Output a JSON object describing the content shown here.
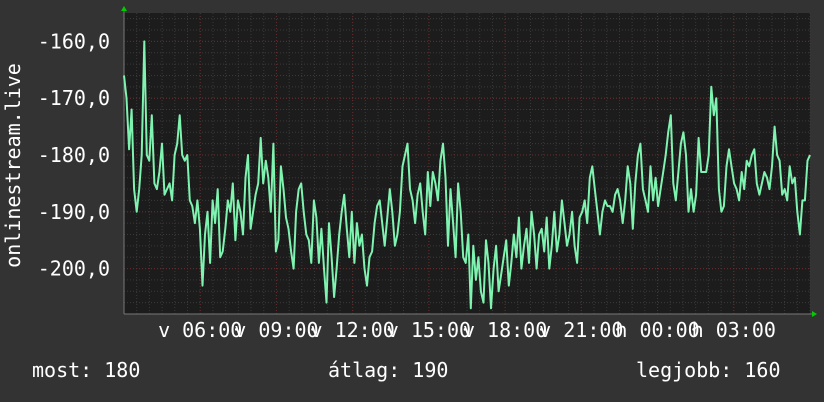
{
  "chart_data": {
    "type": "line",
    "ylabel": "onlinestream.live",
    "ylim": [
      -208,
      -155
    ],
    "yticks": [
      -160,
      -170,
      -180,
      -190,
      -200
    ],
    "ytick_labels": [
      "-160,0",
      "-170,0",
      "-180,0",
      "-190,0",
      "-200,0"
    ],
    "xlim": [
      0,
      270
    ],
    "xticks": [
      {
        "label": "v 06:00",
        "x": 30
      },
      {
        "label": "v 09:00",
        "x": 60
      },
      {
        "label": "v 12:00",
        "x": 90
      },
      {
        "label": "v 15:00",
        "x": 120
      },
      {
        "label": "v 18:00",
        "x": 150
      },
      {
        "label": "v 21:00",
        "x": 180
      },
      {
        "label": "h 00:00",
        "x": 210
      },
      {
        "label": "h 03:00",
        "x": 240
      }
    ],
    "grid": true,
    "colors": {
      "line": "#7ff3b0",
      "plot_bg": "#1c1c1c",
      "grid_minor": "#3a3a3a",
      "grid_major": "#6a2a2a",
      "axis_arrow": "#00cc00"
    },
    "series": [
      {
        "values": [
          -166,
          -170,
          -179,
          -172,
          -186,
          -190,
          -186,
          -180,
          -160,
          -180,
          -181,
          -173,
          -185,
          -186,
          -183,
          -178,
          -187,
          -186,
          -185,
          -188,
          -180,
          -178,
          -173,
          -180,
          -181,
          -180,
          -188,
          -189,
          -192,
          -188,
          -193,
          -203,
          -194,
          -190,
          -199,
          -188,
          -192,
          -186,
          -198,
          -197,
          -193,
          -188,
          -190,
          -185,
          -195,
          -188,
          -190,
          -194,
          -184,
          -180,
          -193,
          -190,
          -187,
          -185,
          -177,
          -185,
          -181,
          -184,
          -190,
          -178,
          -197,
          -195,
          -182,
          -186,
          -191,
          -193,
          -197,
          -200,
          -190,
          -186,
          -185,
          -190,
          -194,
          -195,
          -199,
          -188,
          -191,
          -199,
          -193,
          -200,
          -206,
          -192,
          -198,
          -205,
          -200,
          -194,
          -190,
          -187,
          -193,
          -198,
          -190,
          -199,
          -192,
          -196,
          -194,
          -200,
          -203,
          -198,
          -197,
          -192,
          -189,
          -188,
          -192,
          -196,
          -191,
          -186,
          -190,
          -196,
          -194,
          -190,
          -182,
          -180,
          -178,
          -186,
          -188,
          -192,
          -187,
          -185,
          -190,
          -194,
          -183,
          -189,
          -183,
          -185,
          -188,
          -181,
          -178,
          -184,
          -196,
          -186,
          -192,
          -198,
          -185,
          -190,
          -198,
          -199,
          -194,
          -207,
          -196,
          -202,
          -198,
          -204,
          -206,
          -195,
          -199,
          -207,
          -200,
          -196,
          -204,
          -201,
          -198,
          -195,
          -203,
          -199,
          -194,
          -198,
          -191,
          -200,
          -196,
          -193,
          -199,
          -190,
          -194,
          -200,
          -194,
          -193,
          -197,
          -191,
          -200,
          -196,
          -190,
          -197,
          -194,
          -188,
          -192,
          -196,
          -194,
          -190,
          -196,
          -199,
          -191,
          -190,
          -188,
          -192,
          -184,
          -182,
          -186,
          -190,
          -194,
          -190,
          -188,
          -189,
          -189,
          -190,
          -187,
          -186,
          -188,
          -192,
          -188,
          -182,
          -185,
          -193,
          -185,
          -180,
          -178,
          -186,
          -188,
          -190,
          -182,
          -188,
          -184,
          -189,
          -186,
          -183,
          -180,
          -176,
          -173,
          -185,
          -188,
          -183,
          -178,
          -176,
          -180,
          -190,
          -186,
          -190,
          -187,
          -177,
          -183,
          -183,
          -183,
          -180,
          -168,
          -173,
          -170,
          -186,
          -190,
          -189,
          -182,
          -179,
          -182,
          -185,
          -186,
          -188,
          -183,
          -186,
          -181,
          -182,
          -180,
          -179,
          -185,
          -187,
          -185,
          -183,
          -184,
          -186,
          -182,
          -175,
          -180,
          -181,
          -187,
          -186,
          -188,
          -182,
          -185,
          -184,
          -190,
          -194,
          -188,
          -188,
          -181,
          -180
        ]
      }
    ]
  },
  "stats": {
    "now": "most: 180",
    "avg": "átlag: 190",
    "best": "legjobb: 160"
  }
}
